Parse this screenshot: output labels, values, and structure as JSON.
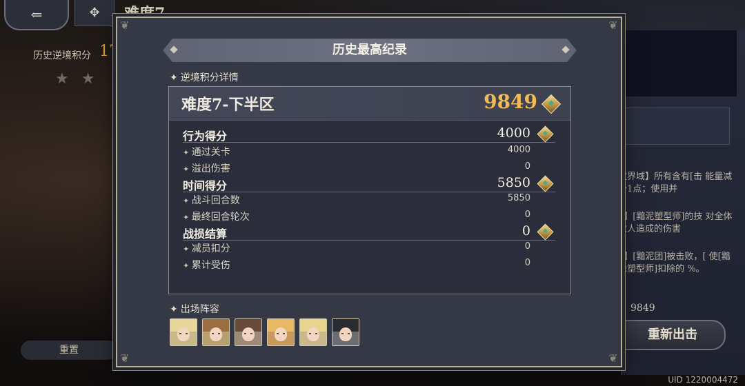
{
  "background": {
    "title": "难度7",
    "score_label": "历史逆境积分",
    "score_value": "17",
    "stars": [
      "★",
      "★"
    ],
    "reset_label": "重置",
    "right_text_1": "定界域】所有含有[击 能量减少1点；使用并",
    "right_text_2": "6】[黯泥塑型师]的技 对全体敌人造成的伤害",
    "right_text_3": "7】[黯泥团]被击败，[ 使[黯蚀塑型师]扣除的 %。",
    "right_score": "：9849",
    "redeploy_label": "重新出击",
    "uid": "UID 1220004472"
  },
  "dialog": {
    "title": "历史最高纪录",
    "section_score": "逆境积分详情",
    "section_lineup": "出场阵容",
    "difficulty": "难度7-下半区",
    "total": "9849",
    "rows": [
      {
        "label": "行为得分",
        "value": "4000",
        "main": true
      },
      {
        "label": "通过关卡",
        "value": "4000",
        "main": false
      },
      {
        "label": "溢出伤害",
        "value": "0",
        "main": false
      },
      {
        "label": "时间得分",
        "value": "5850",
        "main": true
      },
      {
        "label": "战斗回合数",
        "value": "5850",
        "main": false
      },
      {
        "label": "最终回合轮次",
        "value": "0",
        "main": false
      },
      {
        "label": "战损结算",
        "value": "0",
        "main": true
      },
      {
        "label": "减员扣分",
        "value": "0",
        "main": false
      },
      {
        "label": "累计受伤",
        "value": "0",
        "main": false
      }
    ],
    "lineup": [
      {
        "name": "character-1",
        "bg": "#c8b98a",
        "hair": "#e9d79a"
      },
      {
        "name": "character-2",
        "bg": "#b7a070",
        "hair": "#9a6e3e"
      },
      {
        "name": "character-3",
        "bg": "#9b8a7a",
        "hair": "#6a4a3a"
      },
      {
        "name": "character-4",
        "bg": "#c59a5c",
        "hair": "#e8b865"
      },
      {
        "name": "character-5",
        "bg": "#c9b88c",
        "hair": "#e8d48e"
      },
      {
        "name": "character-6",
        "bg": "#6c6d73",
        "hair": "#2a2b30"
      }
    ]
  }
}
